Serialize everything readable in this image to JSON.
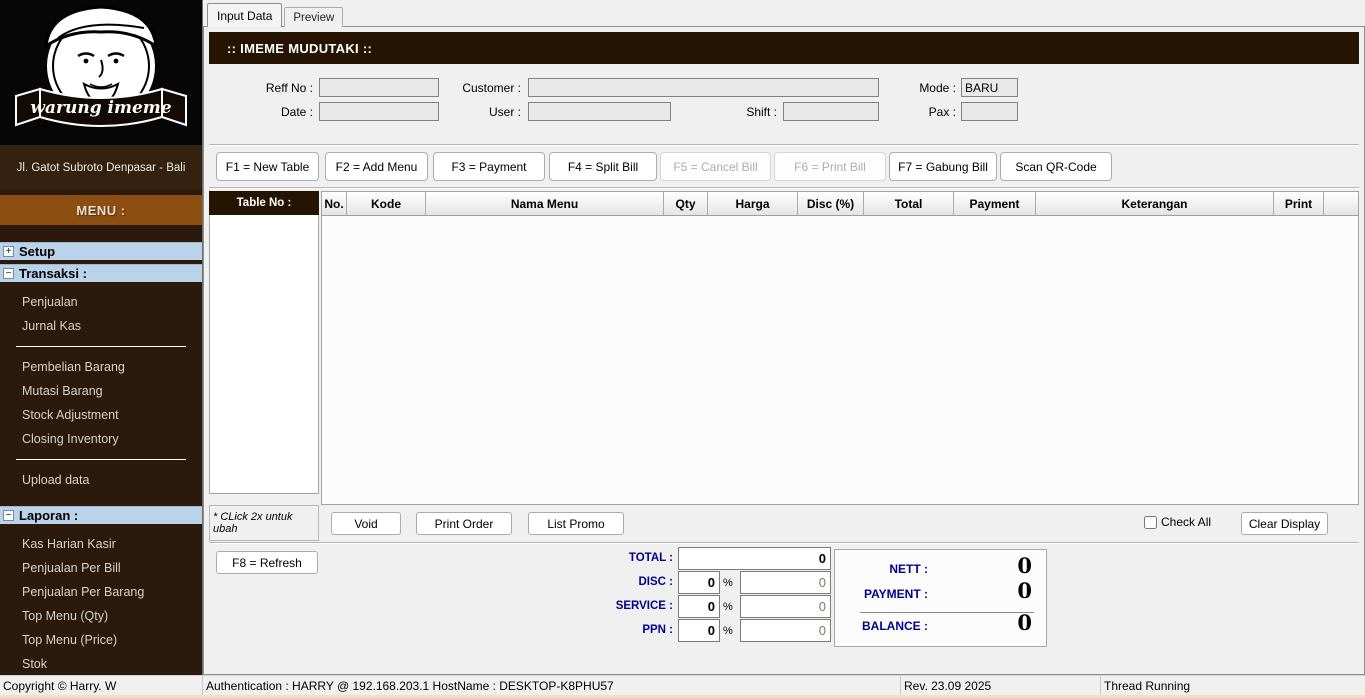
{
  "sidebar": {
    "logo_text": "warung imeme",
    "address": "Jl. Gatot Subroto Denpasar  - Bali",
    "menu_title": "MENU :",
    "sections": {
      "setup": {
        "label": "Setup",
        "expanded": false
      },
      "transaksi": {
        "label": "Transaksi :",
        "expanded": true,
        "items": [
          "Penjualan",
          "Jurnal Kas",
          "Pembelian Barang",
          "Mutasi Barang",
          "Stock Adjustment",
          "Closing Inventory",
          "Upload data"
        ]
      },
      "laporan": {
        "label": "Laporan :",
        "expanded": true,
        "items": [
          "Kas Harian Kasir",
          "Penjualan Per Bill",
          "Penjualan Per Barang",
          "Top Menu (Qty)",
          "Top Menu (Price)",
          "Stok"
        ]
      }
    }
  },
  "icons": {
    "expand": "+",
    "collapse": "−"
  },
  "tabs": {
    "input_data": "Input Data",
    "preview": "Preview"
  },
  "header": {
    "title": ":: IMEME MUDUTAKI ::"
  },
  "form": {
    "reff_no_label": "Reff No :",
    "reff_no_value": "",
    "date_label": "Date :",
    "date_value": "",
    "customer_label": "Customer :",
    "customer_value": "",
    "user_label": "User :",
    "user_value": "",
    "shift_label": "Shift :",
    "shift_value": "",
    "mode_label": "Mode :",
    "mode_value": "BARU",
    "pax_label": "Pax :",
    "pax_value": ""
  },
  "toolbar": {
    "f1": "F1 = New Table",
    "f2": "F2 = Add Menu",
    "f3": "F3 = Payment",
    "f4": "F4 = Split Bill",
    "f5": "F5 = Cancel Bill",
    "f6": "F6 = Print Bill",
    "f7": "F7 = Gabung Bill",
    "qr": "Scan QR-Code",
    "disabled_buttons": [
      "F5 = Cancel Bill",
      "F6 = Print Bill"
    ]
  },
  "table_panel": {
    "header": "Table No :",
    "hint": "* CLick 2x untuk ubah",
    "rows": []
  },
  "grid": {
    "columns": [
      "No.",
      "Kode",
      "Nama Menu",
      "Qty",
      "Harga",
      "Disc (%)",
      "Total",
      "Payment",
      "Keterangan",
      "Print"
    ],
    "rows": []
  },
  "actions": {
    "void": "Void",
    "print_order": "Print Order",
    "list_promo": "List Promo",
    "check_all": "Check All",
    "check_all_checked": false,
    "clear_display": "Clear Display",
    "refresh": "F8 = Refresh"
  },
  "totals": {
    "total_label": "TOTAL :",
    "total_value": "0",
    "disc_label": "DISC :",
    "disc_percent": "0",
    "disc_value": "0",
    "service_label": "SERVICE :",
    "service_percent": "0",
    "service_value": "0",
    "ppn_label": "PPN :",
    "ppn_percent": "0",
    "ppn_value": "0",
    "percent_sign": "%",
    "nett_label": "NETT :",
    "nett_value": "0",
    "payment_label": "PAYMENT :",
    "payment_value": "0",
    "balance_label": "BALANCE :",
    "balance_value": "0"
  },
  "statusbar": {
    "copyright": "Copyright © Harry. W",
    "authentication": "Authentication : HARRY @ 192.168.203.1 HostName : DESKTOP-K8PHU57",
    "revision": "Rev. 23.09 2025",
    "thread": "Thread Running"
  },
  "colors": {
    "dark_brown": "#261403",
    "sidebar_brown": "#2B1A0B",
    "menu_bar_brown": "#8C4E11",
    "section_header_blue": "#BAD2EA",
    "navy_label": "#00008B",
    "status_edge_tan": "#EFE2C0"
  }
}
